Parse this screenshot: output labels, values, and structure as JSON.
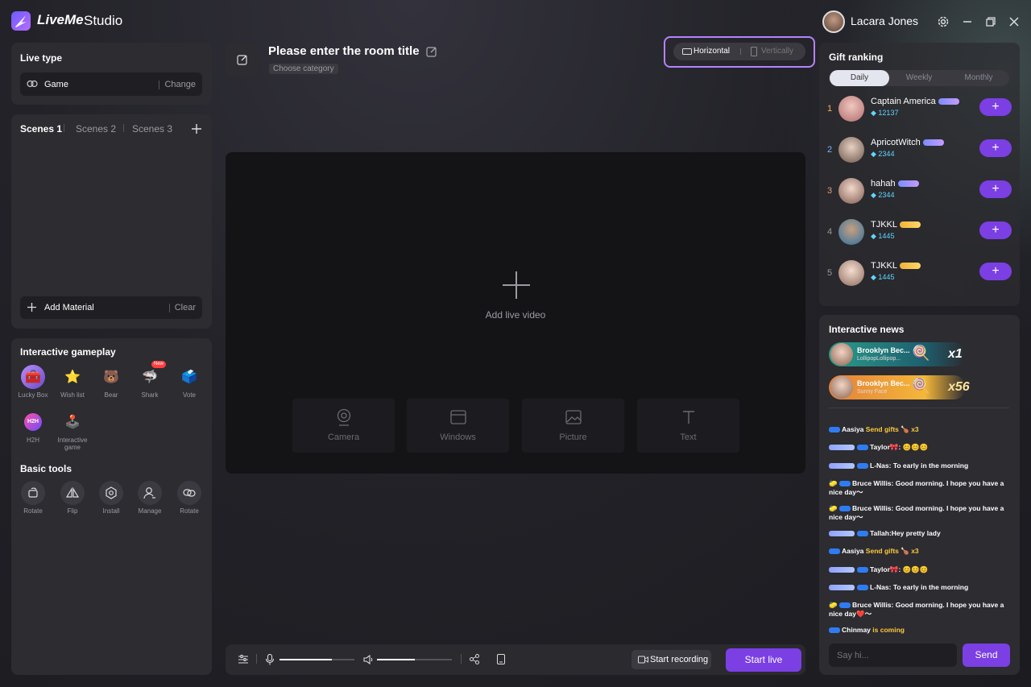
{
  "app": {
    "brand": "LiveMe",
    "separator": "·",
    "title": "Studio"
  },
  "user": {
    "name": "Lacara Jones"
  },
  "live_type": {
    "heading": "Live type",
    "value": "Game",
    "change_label": "Change"
  },
  "scenes": {
    "tabs": [
      "Scenes 1",
      "Scenes 2",
      "Scenes 3"
    ],
    "active": "Scenes 1",
    "add_material_label": "Add Material",
    "clear_label": "Clear"
  },
  "interactive_gameplay": {
    "heading": "Interactive gameplay",
    "items": [
      {
        "label": "Lucky Box",
        "icon": "lucky-box-icon"
      },
      {
        "label": "Wish list",
        "icon": "star-icon"
      },
      {
        "label": "Bear",
        "icon": "bear-icon"
      },
      {
        "label": "Shark",
        "icon": "shark-icon",
        "badge": "New"
      },
      {
        "label": "Vote",
        "icon": "vote-icon"
      },
      {
        "label": "H2H",
        "icon": "h2h-icon"
      },
      {
        "label": "Interactive game",
        "icon": "joystick-icon"
      }
    ]
  },
  "basic_tools": {
    "heading": "Basic tools",
    "items": [
      {
        "label": "Rotate",
        "icon": "rotate-icon"
      },
      {
        "label": "Flip",
        "icon": "flip-icon"
      },
      {
        "label": "Install",
        "icon": "install-icon"
      },
      {
        "label": "Manage",
        "icon": "manage-icon"
      },
      {
        "label": "Rotate",
        "icon": "link-icon"
      }
    ]
  },
  "room": {
    "title": "Please enter the room title",
    "category": "Choose category"
  },
  "orientation": {
    "horizontal": "Horizontal",
    "vertical": "Vertically",
    "selected": "Horizontal"
  },
  "canvas": {
    "add_label": "Add live video"
  },
  "sources": [
    "Camera",
    "Windows",
    "Picture",
    "Text"
  ],
  "bottom_bar": {
    "mic_level": 0.7,
    "volume_level": 0.5,
    "record_label": "Start recording",
    "start_label": "Start live"
  },
  "gift_ranking": {
    "heading": "Gift ranking",
    "tabs": [
      "Daily",
      "Weekly",
      "Monthly"
    ],
    "active_tab": "Daily",
    "entries": [
      {
        "rank": "1",
        "name": "Captain America",
        "gems": "12137"
      },
      {
        "rank": "2",
        "name": "ApricotWitch",
        "gems": "2344"
      },
      {
        "rank": "3",
        "name": "hahah",
        "gems": "2344"
      },
      {
        "rank": "4",
        "name": "TJKKL",
        "gems": "1445"
      },
      {
        "rank": "5",
        "name": "TJKKL",
        "gems": "1445"
      }
    ],
    "add_symbol": "+"
  },
  "news": {
    "heading": "Interactive news",
    "banners": [
      {
        "name": "Brooklyn Bec...",
        "gift": "LollipopLollipop...",
        "count": "x1"
      },
      {
        "name": "Brooklyn Bec...",
        "gift": "Sunny Face",
        "count": "x56"
      }
    ],
    "messages": [
      {
        "user": "Aasiya",
        "text": "Send gifts 🍗 x3"
      },
      {
        "user": "Taylor🎀",
        "text": ": 😊😊😊"
      },
      {
        "user": "L-Nas",
        "text": ": To early in the morning"
      },
      {
        "user": "Bruce Willis",
        "text": ": Good morning. I hope  you have a nice day～"
      },
      {
        "user": "Bruce Willis",
        "text": ": Good morning. I hope  you have a nice day～"
      },
      {
        "user": "Tallah",
        "text": ":Hey pretty lady"
      },
      {
        "user": "Aasiya",
        "text": "Send gifts 🍗 x3"
      },
      {
        "user": "Taylor🎀",
        "text": ": 😊😊😊"
      },
      {
        "user": "L-Nas",
        "text": ": To early in the morning"
      },
      {
        "user": "Bruce Willis",
        "text": ": Good morning. I hope  you have a nice day❤️～"
      },
      {
        "user": "Chinmay",
        "text": "is coming"
      }
    ],
    "input_placeholder": "Say hi...",
    "send_label": "Send"
  },
  "colors": {
    "accent": "#7b3fe4",
    "highlight": "#b583ff",
    "panel": "#2c2c31"
  }
}
